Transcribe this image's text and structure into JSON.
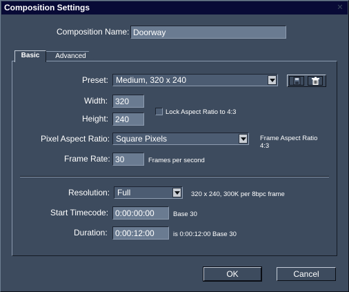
{
  "window": {
    "title": "Composition Settings"
  },
  "composition_name": {
    "label": "Composition Name:",
    "value": "Doorway"
  },
  "tabs": [
    {
      "label": "Basic",
      "active": true
    },
    {
      "label": "Advanced",
      "active": false
    }
  ],
  "preset": {
    "label": "Preset:",
    "value": "Medium, 320 x 240"
  },
  "width": {
    "label": "Width:",
    "value": "320"
  },
  "height": {
    "label": "Height:",
    "value": "240"
  },
  "lock_aspect": {
    "label": "Lock Aspect Ratio to 4:3",
    "checked": false
  },
  "pixel_aspect": {
    "label": "Pixel Aspect Ratio:",
    "value": "Square Pixels"
  },
  "frame_aspect": {
    "label": "Frame Aspect Ratio",
    "value": "4:3"
  },
  "frame_rate": {
    "label": "Frame Rate:",
    "value": "30",
    "unit": "Frames per second"
  },
  "resolution": {
    "label": "Resolution:",
    "value": "Full",
    "info": "320 x 240, 300K per 8bpc frame"
  },
  "start_timecode": {
    "label": "Start Timecode:",
    "value": "0:00:00:00",
    "base": "Base 30"
  },
  "duration": {
    "label": "Duration:",
    "value": "0:00:12:00",
    "info": "is 0:00:12:00  Base 30"
  },
  "buttons": {
    "ok": "OK",
    "cancel": "Cancel"
  },
  "icons": {
    "save_preset": "save-disk-icon",
    "delete_preset": "trash-icon",
    "close": "close-icon"
  },
  "colors": {
    "title_bar": "#080a36",
    "dialog_bg": "#3d4b5e",
    "field_bg": "#6a7b91"
  }
}
